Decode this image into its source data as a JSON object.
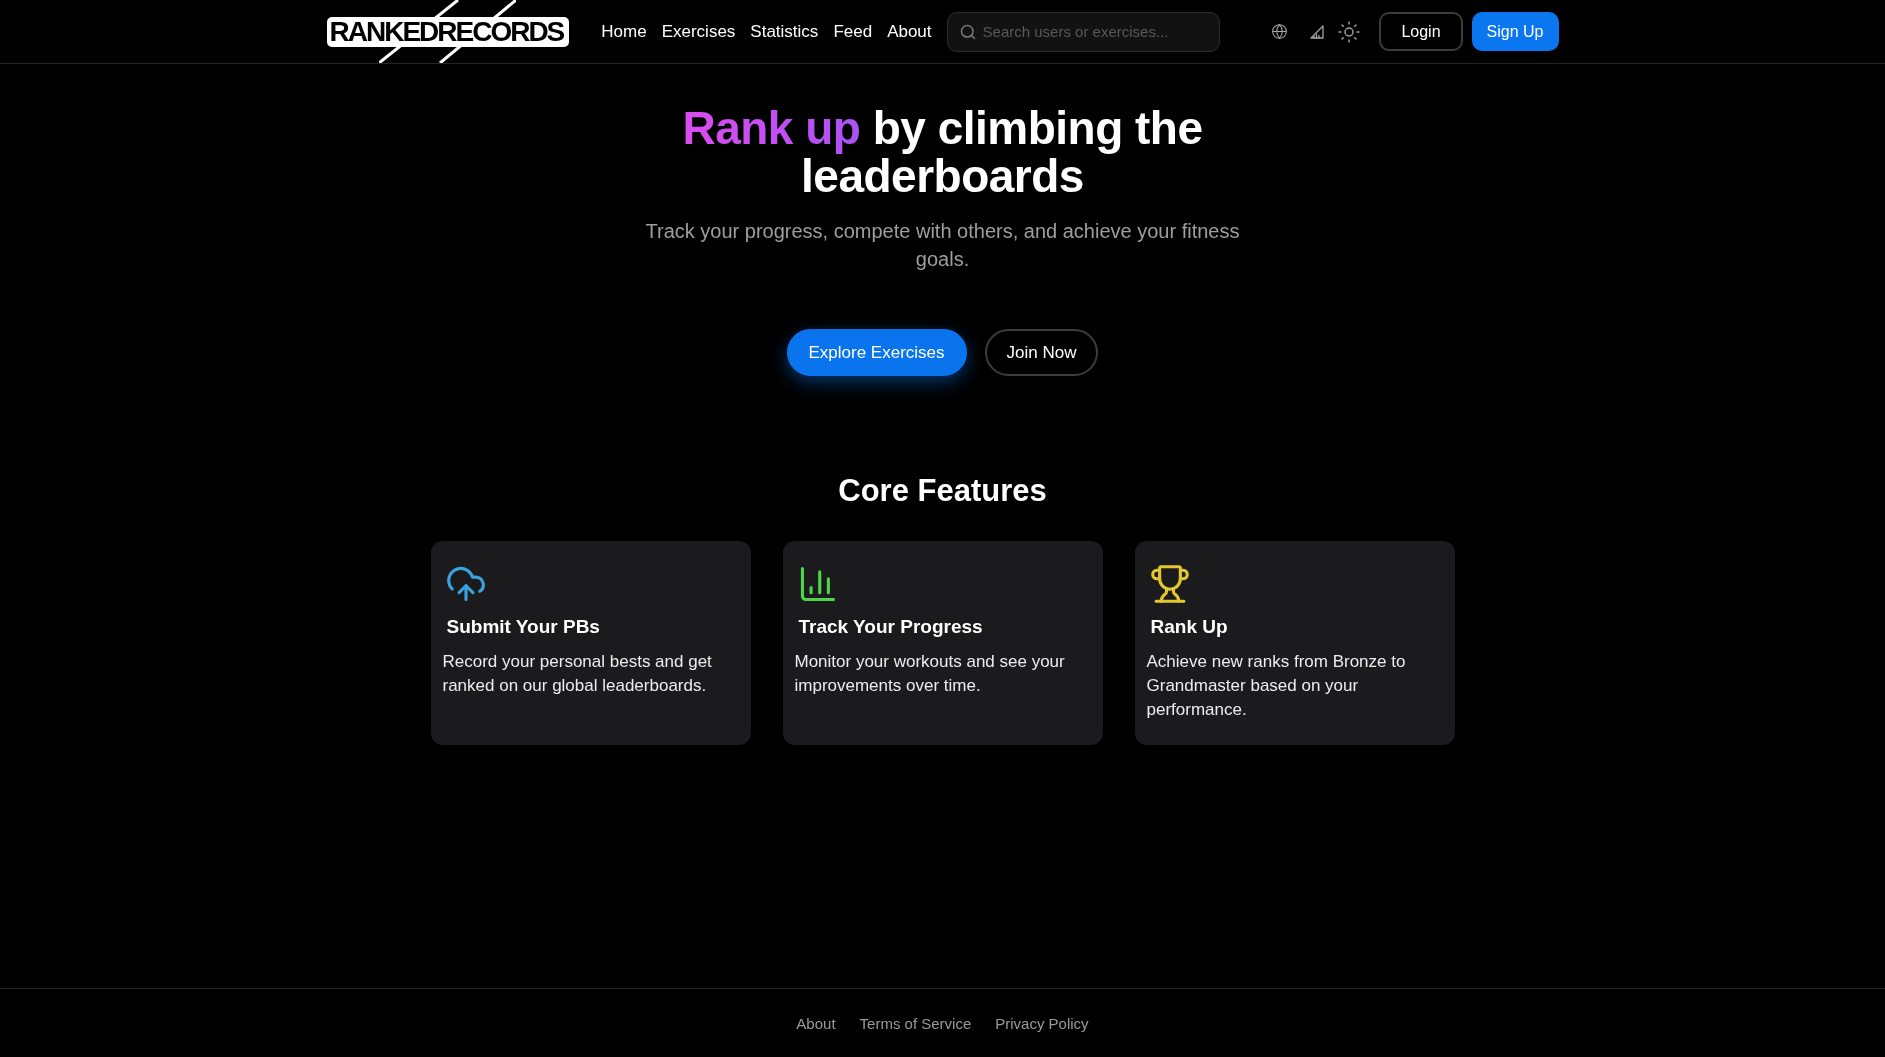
{
  "header": {
    "logo": "RANKEDRECORDS",
    "nav": [
      "Home",
      "Exercises",
      "Statistics",
      "Feed",
      "About"
    ],
    "search": {
      "placeholder": "Search users or exercises..."
    },
    "buttons": [
      {
        "label": "Login",
        "kind": "outline"
      },
      {
        "label": "Sign Up",
        "kind": "primary"
      }
    ]
  },
  "hero": {
    "title": {
      "highlight": "Rank up",
      "rest": "by climbing the leaderboards"
    },
    "subtitle": "Track your progress, compete with others, and achieve your fitness goals.",
    "buttons": [
      {
        "label": "Explore Exercises",
        "kind": "primary"
      },
      {
        "label": "Join Now",
        "kind": "outline"
      }
    ]
  },
  "features": {
    "title": "Core Features",
    "items": [
      {
        "title": "Submit Your PBs",
        "description": "Record your personal bests and get ranked on our global leaderboards.",
        "color": "#3ba2e0"
      },
      {
        "title": "Track Your Progress",
        "description": "Monitor your workouts and see your improvements over time.",
        "color": "#4cd64a"
      },
      {
        "title": "Rank Up",
        "description": "Achieve new ranks from Bronze to Grandmaster based on your performance.",
        "color": "#e3c72c"
      }
    ]
  },
  "footer": {
    "links": [
      "About",
      "Terms of Service",
      "Privacy Policy"
    ]
  }
}
